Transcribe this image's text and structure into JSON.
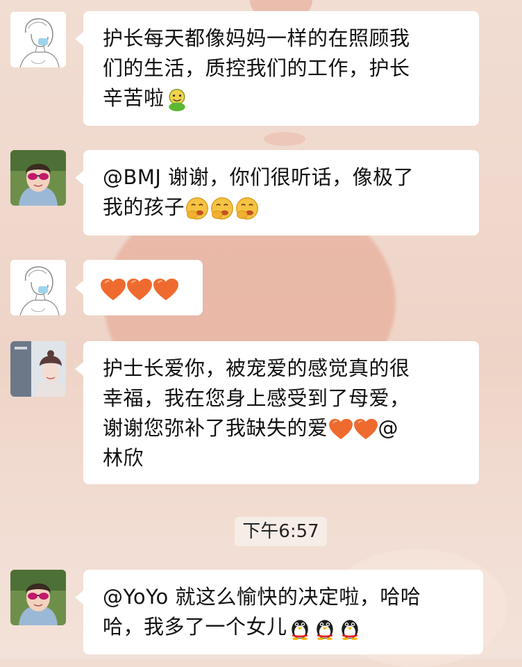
{
  "background_color": "#f0d8cd",
  "bubble_color": "#ffffff",
  "messages": [
    {
      "avatar_icon": "sketch-girl-mask-avatar",
      "lines": [
        "护长每天都像妈妈一样的在照顾我",
        "们的生活，质控我们的工作，护长",
        "辛苦啦"
      ],
      "trailing_emoji": [
        "green-smiley-icon"
      ]
    },
    {
      "avatar_icon": "woman-sunglasses-avatar",
      "lines": [
        "@BMJ 谢谢，你们很听话，像极了",
        "我的孩子"
      ],
      "trailing_emoji": [
        "giggle-face-icon",
        "giggle-face-icon",
        "giggle-face-icon"
      ]
    },
    {
      "avatar_icon": "sketch-girl-mask-avatar",
      "lines": [],
      "trailing_emoji": [
        "heart-icon",
        "heart-icon",
        "heart-icon"
      ]
    },
    {
      "avatar_icon": "girl-knit-hat-avatar",
      "lines": [
        "护士长爱你，被宠爱的感觉真的很",
        "幸福，我在您身上感受到了母爱，",
        "谢谢您弥补了我缺失的爱",
        "林欣"
      ],
      "inline_tail": "@"
    },
    {
      "avatar_icon": "woman-sunglasses-avatar",
      "lines": [
        "@YoYo 就这么愉快的决定啦，哈哈",
        "哈，我多了一个女儿"
      ],
      "trailing_emoji": [
        "penguin-icon",
        "penguin-icon",
        "penguin-icon"
      ]
    }
  ],
  "timestamp": "下午6:57"
}
